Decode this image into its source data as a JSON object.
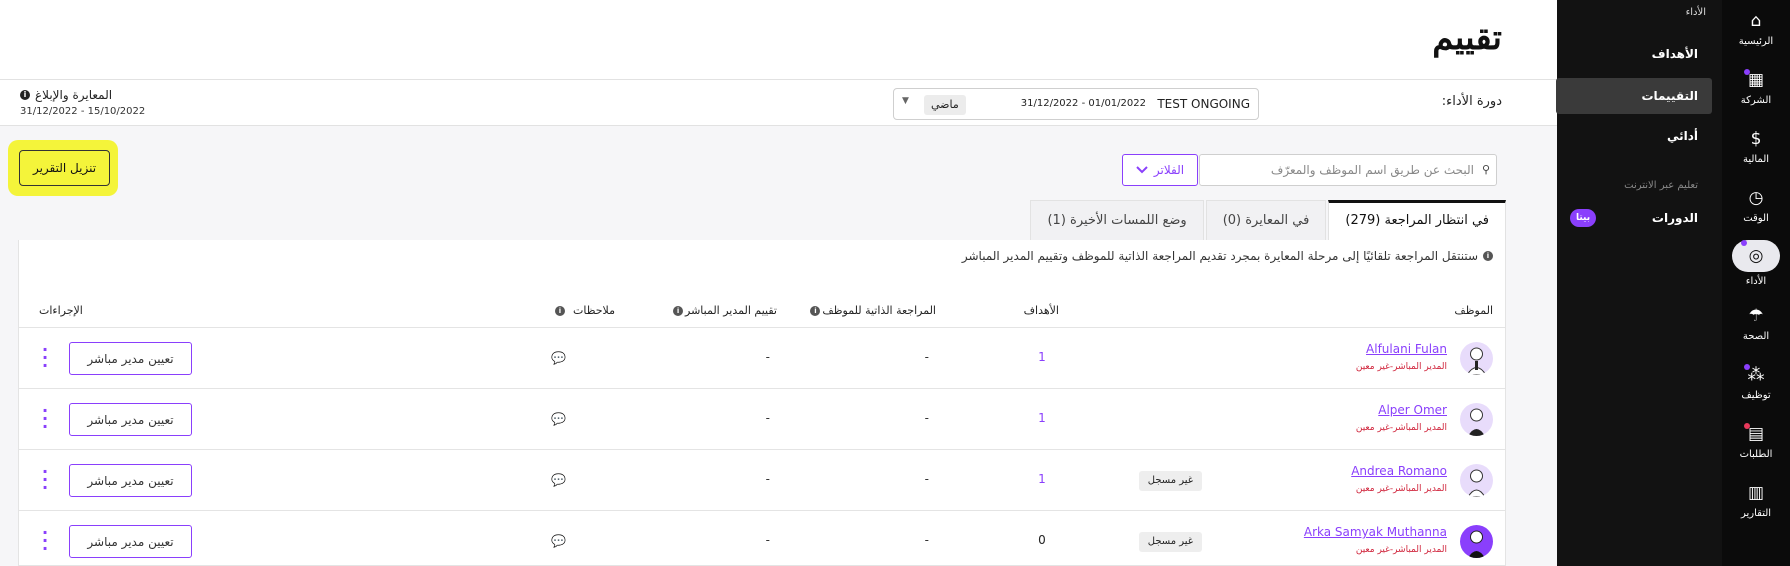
{
  "rail": {
    "items": [
      {
        "label": "الرئيسية",
        "icon": "home-icon",
        "glyph": "⌂",
        "dot": false
      },
      {
        "label": "الشركة",
        "icon": "building-icon",
        "glyph": "▦",
        "dot": true
      },
      {
        "label": "المالية",
        "icon": "dollar-icon",
        "glyph": "$",
        "dot": false
      },
      {
        "label": "الوقت",
        "icon": "clock-icon",
        "glyph": "◷",
        "dot": false
      },
      {
        "label": "الأداء",
        "icon": "target-icon",
        "glyph": "◎",
        "dot": true,
        "active": true
      },
      {
        "label": "الصحة",
        "icon": "umbrella-icon",
        "glyph": "☂",
        "dot": false
      },
      {
        "label": "توظيف",
        "icon": "people-icon",
        "glyph": "⁂",
        "dot": true
      },
      {
        "label": "الطلبات",
        "icon": "clipboard-icon",
        "glyph": "▤",
        "dot": true
      },
      {
        "label": "التقارير",
        "icon": "chart-icon",
        "glyph": "▥",
        "dot": false
      }
    ]
  },
  "subnav": {
    "header": "الأداء",
    "items": [
      {
        "label": "الأهداف",
        "active": false
      },
      {
        "label": "التقييمات",
        "active": true
      },
      {
        "label": "أدائي",
        "active": false
      }
    ],
    "section_label": "تعليم عبر الانترنت",
    "courses_label": "الدورات",
    "beta_badge": "بيتا"
  },
  "header": {
    "title": "تقييم"
  },
  "cycle": {
    "label": "دورة الأداء:",
    "name": "TEST ONGOING",
    "dates": "31/12/2022 - 01/01/2022",
    "status_pill": "ماضي"
  },
  "calibration": {
    "title": "المعايرة والإبلاغ",
    "dates": "31/12/2022 - 15/10/2022"
  },
  "toolbar": {
    "download_label": "تنزيل التقرير",
    "search_placeholder": "البحث عن طريق اسم الموظف والمعرّف",
    "filters_label": "الفلاتر"
  },
  "tabs": [
    {
      "label": "في انتظار المراجعة (279)",
      "active": true
    },
    {
      "label": "في المعايرة (0)",
      "active": false
    },
    {
      "label": "وضع اللمسات الأخيرة (1)",
      "active": false
    }
  ],
  "notice": "ستنتقل المراجعة تلقائيًا إلى مرحلة المعايرة بمجرد تقديم المراجعة الذاتية للموظف وتقييم المدير المباشر",
  "table": {
    "columns": {
      "employee": "الموظف",
      "goals": "الأهداف",
      "self_review": "المراجعة الذاتية للموظف",
      "manager_rating": "تقييم المدير المباشر",
      "notes": "ملاحظات",
      "actions": "الإجراءات"
    },
    "rows": [
      {
        "name": "Alfulani Fulan",
        "sub": "المدير المباشر-غير معين",
        "tag": "",
        "goals": "1",
        "self_review": "-",
        "manager_rating": "-",
        "assign_label": "تعيين مدير مباشر"
      },
      {
        "name": "Alper Omer",
        "sub": "المدير المباشر-غير معين",
        "tag": "",
        "goals": "1",
        "self_review": "-",
        "manager_rating": "-",
        "assign_label": "تعيين مدير مباشر"
      },
      {
        "name": "Andrea Romano",
        "sub": "المدير المباشر-غير معين",
        "tag": "غير مسجل",
        "goals": "1",
        "self_review": "-",
        "manager_rating": "-",
        "assign_label": "تعيين مدير مباشر"
      },
      {
        "name": "Arka Samyak Muthanna",
        "sub": "المدير المباشر-غير معين",
        "tag": "غير مسجل",
        "goals": "0",
        "self_review": "-",
        "manager_rating": "-",
        "assign_label": "تعيين مدير مباشر"
      }
    ]
  },
  "colors": {
    "accent": "#8a3ffc",
    "highlight": "#f4f43a",
    "sidebar": "#0b0b0b",
    "warning_text": "#d0243b"
  }
}
